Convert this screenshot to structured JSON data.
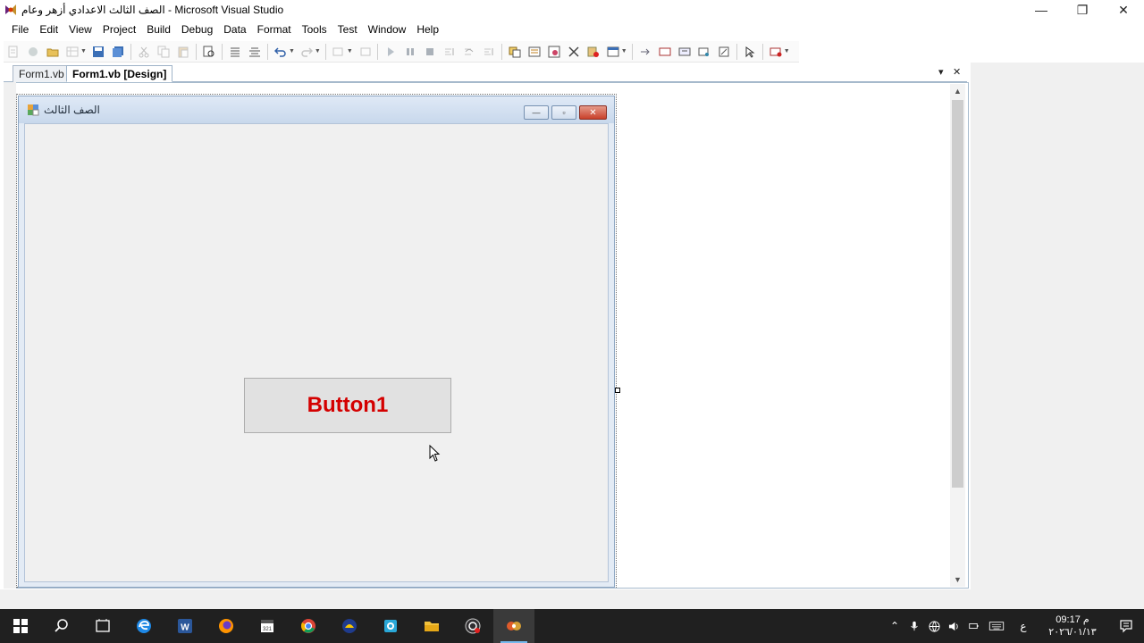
{
  "window": {
    "title": "الصف الثالث الاعدادي أزهر وعام - Microsoft Visual Studio",
    "controls": [
      "—",
      "❐",
      "✕"
    ]
  },
  "menu": [
    "File",
    "Edit",
    "View",
    "Project",
    "Build",
    "Debug",
    "Data",
    "Format",
    "Tools",
    "Test",
    "Window",
    "Help"
  ],
  "tabs": {
    "inactive": "Form1.vb",
    "active": "Form1.vb [Design]",
    "dropdown": "▾",
    "close": "✕"
  },
  "form": {
    "title": "الصف الثالث",
    "minimize": "—",
    "maximize": "▫",
    "close": "✕",
    "button_text": "Button1"
  },
  "taskbar": {
    "tray_lang": "ع",
    "time": "09:17 م",
    "date": "٢٠٢٦/٠١/١٣"
  },
  "colors": {
    "button_text": "#d40000",
    "taskbar": "#202020",
    "form_title": "#c8d8ec"
  }
}
